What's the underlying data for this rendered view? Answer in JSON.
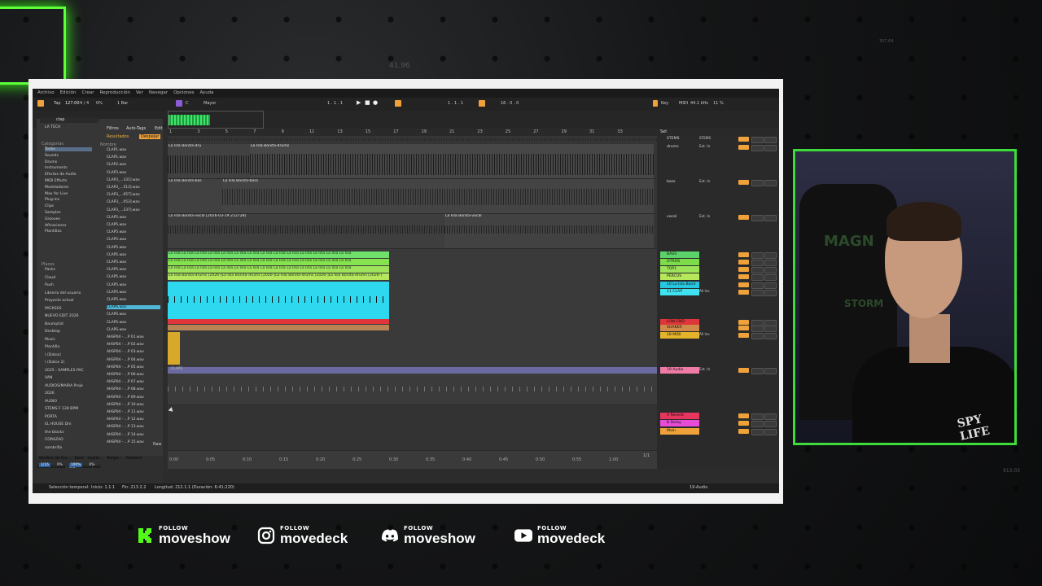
{
  "background": {
    "numbers": [
      "41.96",
      "307.64",
      "913.03"
    ]
  },
  "daw": {
    "menu": [
      "Archivo",
      "Edición",
      "Crear",
      "Reproducción",
      "Ver",
      "Navegar",
      "Opciones",
      "Ayuda"
    ],
    "transport": {
      "tap": "Tap",
      "tempo": "127.00",
      "signature": "4 / 4",
      "metro": "0%",
      "quant": "1 Bar",
      "key": "C",
      "scale": "Mayor",
      "position": "1 . 1 . 1",
      "loop_start": "1 . 1 . 1",
      "loop_length": "16 . 0 . 0",
      "key_btn": "Key",
      "midi_btn": "MIDI",
      "sample_rate": "44.1 kHz",
      "cpu": "11 %"
    },
    "browser": {
      "search": "clap",
      "collection": "LA TECA",
      "filters_label": "Filtros",
      "autotags_label": "Auto-Tags",
      "edit_label": "Edit",
      "results_label": "Resultados",
      "clear_label": "Despejar",
      "name_header": "Nombre",
      "categories_header": "Categorías",
      "categories": [
        "Todos",
        "Sounds",
        "Drums",
        "Instruments",
        "Efectos de Audio",
        "MIDI Effects",
        "Modeladores",
        "Max for Live",
        "Plug-ins",
        "Clips",
        "Samples",
        "Grooves",
        "Afinaciones",
        "Plantillas"
      ],
      "places_header": "Places",
      "places": [
        "Packs",
        "Cloud",
        "Push",
        "Librería del usuario",
        "Proyecto actual",
        "PACKSSS",
        "NUEVO EDIT 2026",
        "Baumplist",
        "Desktop",
        "Music",
        "Plantilla",
        "\\ (Datos)",
        "\\ (Datos 2)",
        "2025 - SAMPLES PAC",
        "VAN",
        "AUDIOS/MAIRA Proje",
        "2026",
        "AUDIO",
        "STEMS F 128 BPM",
        "PORTA",
        "EL HOUSE Dm",
        "the blocks",
        "CORAZAO",
        "sombrilla"
      ],
      "files": [
        "CLAP1.wav",
        "CLAP1.wav",
        "CLAP2.wav",
        "CLAP3.wav",
        "CLAP3_...331].wav",
        "CLAP3_...513].wav",
        "CLAP3_...657].wav",
        "CLAP3_...053].wav",
        "CLAP3_...237].wav",
        "CLAP5.wav",
        "CLAP5.wav",
        "CLAP5.wav",
        "CLAP5.wav",
        "CLAP5.wav",
        "CLAP5.wav",
        "CLAP5.wav",
        "CLAP5.wav",
        "CLAP5.wav",
        "CLAP5.wav",
        "CLAP5.wav",
        "CLAP5.wav",
        "CLAPS.wav",
        "CLAPS.wav",
        "CLAPS.wav",
        "CLAPS.wav",
        "AHSP04 - ...P 01.wav",
        "AHSP04 - ...P 02.wav",
        "AHSP04 - ...P 03.wav",
        "AHSP04 - ...P 04.wav",
        "AHSP04 - ...P 05.wav",
        "AHSP04 - ...P 06.wav",
        "AHSP04 - ...P 07.wav",
        "AHSP04 - ...P 08.wav",
        "AHSP04 - ...P 09.wav",
        "AHSP04 - ...P 10.wav",
        "AHSP04 - ...P 11.wav",
        "AHSP04 - ...P 12.wav",
        "AHSP04 - ...P 13.wav",
        "AHSP04 - ...P 14.wav",
        "AHSP04 - ...P 15.wav"
      ],
      "raw_label": "Raw",
      "groove_headers": [
        "Nombre del Gro...",
        "Base",
        "Cuanti...",
        "Tempo...",
        "Aleatorio"
      ],
      "groove_values": [
        "1/16",
        "0%",
        "100%",
        "0%"
      ],
      "global_amount": "Cantidad Global",
      "global_value": "0%",
      "groove_pool": "Groove Pool"
    },
    "ruler": [
      "1",
      "3",
      "5",
      "7",
      "9",
      "11",
      "13",
      "15",
      "17",
      "19",
      "21",
      "23",
      "25",
      "27",
      "29",
      "31",
      "33"
    ],
    "set_label": "Set",
    "clips": {
      "drums1": "La Isla Bonita-dru",
      "drums2": "La Isla Bonita-drums",
      "bass": "La Isla Bonita-bas",
      "bass2": "La Isla Bonita-bass",
      "vocal1": "La Isla Bonita-vocal [2026-03-19 212728]",
      "vocal2": "La Isla Bonita-vocal",
      "green_row": "La Isla La Isla La Isla La Isla La Isla La Isla La Isla La Isla La Isla La Isla La Isla La Isla La Isla La Isla",
      "green_row3": "La Isla Bonita-drums [2026-]La Isla Bonita-drums [2026-]La Isla Bonita-drums [2026-]La Isla Bonita-drums [2026-]",
      "claps_lane": "CLAPS"
    },
    "tracks": [
      {
        "name": "STEMS",
        "color": "#2a2a2a",
        "io": "STEMS"
      },
      {
        "name": "drums",
        "color": "#2a2a2a",
        "io": "Ext. In"
      },
      {
        "name": "bass",
        "color": "#2a2a2a",
        "io": "Ext. In"
      },
      {
        "name": "vocal",
        "color": "#2a2a2a",
        "io": "Ext. In"
      },
      {
        "name": "BASS",
        "color": "#5bd36a",
        "io": ""
      },
      {
        "name": "OTROS",
        "color": "#7ddc4a",
        "io": ""
      },
      {
        "name": "TOP1",
        "color": "#9ce35a",
        "io": ""
      },
      {
        "name": "PERCUS",
        "color": "#b7e85c",
        "io": ""
      },
      {
        "name": "10 La Isla Bonit",
        "color": "#26c6e0",
        "io": ""
      },
      {
        "name": "11 CLAP",
        "color": "#3fe3f0",
        "io": "All Ins"
      },
      {
        "name": "LOW END",
        "color": "#e0353a",
        "io": ""
      },
      {
        "name": "SHAKER",
        "color": "#d08a4a",
        "io": ""
      },
      {
        "name": "18 MIDI",
        "color": "#e3b42a",
        "io": "All Ins"
      },
      {
        "name": "19 Audio",
        "color": "#f07aa6",
        "io": "Ext. In"
      },
      {
        "name": "A Reverb",
        "color": "#e8355e",
        "io": ""
      },
      {
        "name": "B Delay",
        "color": "#e84bd6",
        "io": ""
      },
      {
        "name": "Main",
        "color": "#f0a23a",
        "io": ""
      }
    ],
    "timeline": [
      "0:00",
      "0:05",
      "0:10",
      "0:15",
      "0:20",
      "0:25",
      "0:30",
      "0:35",
      "0:40",
      "0:45",
      "0:50",
      "0:55",
      "1:00"
    ],
    "page_indicator": "1/1",
    "status": {
      "left": "Selección temporal:",
      "start": "Inicio: 1.1.1",
      "end": "Fin: 213.2.2",
      "length": "Longitud: 212.1.1 (Duración: 6:41:220)",
      "track": "19-Audio"
    }
  },
  "socials": [
    {
      "network": "kick",
      "follow": "FOLLOW",
      "handle": "moveshow"
    },
    {
      "network": "instagram",
      "follow": "FOLLOW",
      "handle": "movedeck"
    },
    {
      "network": "discord",
      "follow": "FOLLOW",
      "handle": "moveshow"
    },
    {
      "network": "youtube",
      "follow": "FOLLOW",
      "handle": "movedeck"
    }
  ],
  "webcam": {
    "shirt_text": "SPY LIFE",
    "chair_text": "MAGN",
    "chair_text2": "STORM"
  }
}
